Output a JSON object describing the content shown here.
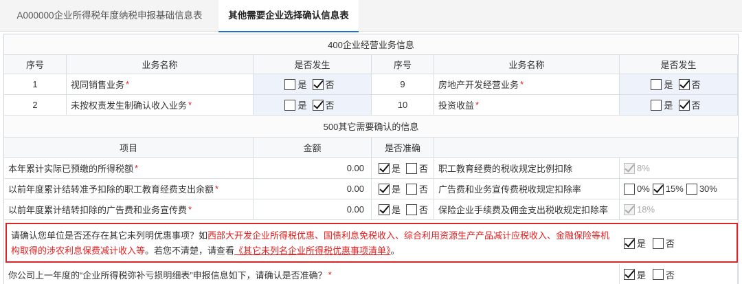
{
  "tabs": [
    {
      "label": "A000000企业所得税年度纳税申报基础信息表"
    },
    {
      "label": "其他需要企业选择确认信息表"
    }
  ],
  "section400": {
    "title": "400企业经营业务信息",
    "headers": {
      "seq": "序号",
      "name": "业务名称",
      "occurred": "是否发生"
    },
    "rows": [
      {
        "seq_left": "1",
        "name_left": "视同销售业务",
        "seq_right": "9",
        "name_right": "房地产开发经营业务"
      },
      {
        "seq_left": "2",
        "name_left": "未按权责发生制确认收入业务",
        "seq_right": "10",
        "name_right": "投资收益"
      }
    ],
    "yes": "是",
    "no": "否"
  },
  "section500": {
    "title": "500其它需要确认的信息",
    "headers": {
      "item": "项目",
      "amount": "金额",
      "accurate": "是否准确"
    },
    "rows": [
      {
        "item": "本年累计实际已预缴的所得税额",
        "amount": "0.00",
        "right_label": "职工教育经费的税收规定比例扣除",
        "right_value": "8%"
      },
      {
        "item": "以前年度累计结转准予扣除的职工教育经费支出余额",
        "amount": "0.00",
        "right_label": "广告费和业务宣传费税收规定扣除率",
        "opts": [
          "0%",
          "15%",
          "30%"
        ]
      },
      {
        "item": "以前年度累计结转扣除的广告费和业务宣传费",
        "amount": "0.00",
        "right_label": "保险企业手续费及佣金支出税收规定扣除率",
        "right_value": "18%"
      }
    ],
    "yes": "是",
    "no": "否"
  },
  "notice": {
    "prefix": "请确认您单位是否还存在其它未列明优惠事项？如",
    "red_items": "西部大开发企业所得税优惠、国债利息免税收入、综合利用资源生产产品减计应税收入、金融保险等机构取得的涉农利息保费减计收入等",
    "middle": "。若您不清楚，请查看",
    "link": "《其它未列名企业所得税优惠事项清单》",
    "suffix": "。",
    "yes": "是",
    "no": "否"
  },
  "last_question": {
    "text": "你公司上一年度的“企业所得税弥补亏损明细表”申报信息如下，请确认是否准确？",
    "required_mark": "*",
    "yes": "是",
    "no": "否"
  },
  "required_mark": "*"
}
